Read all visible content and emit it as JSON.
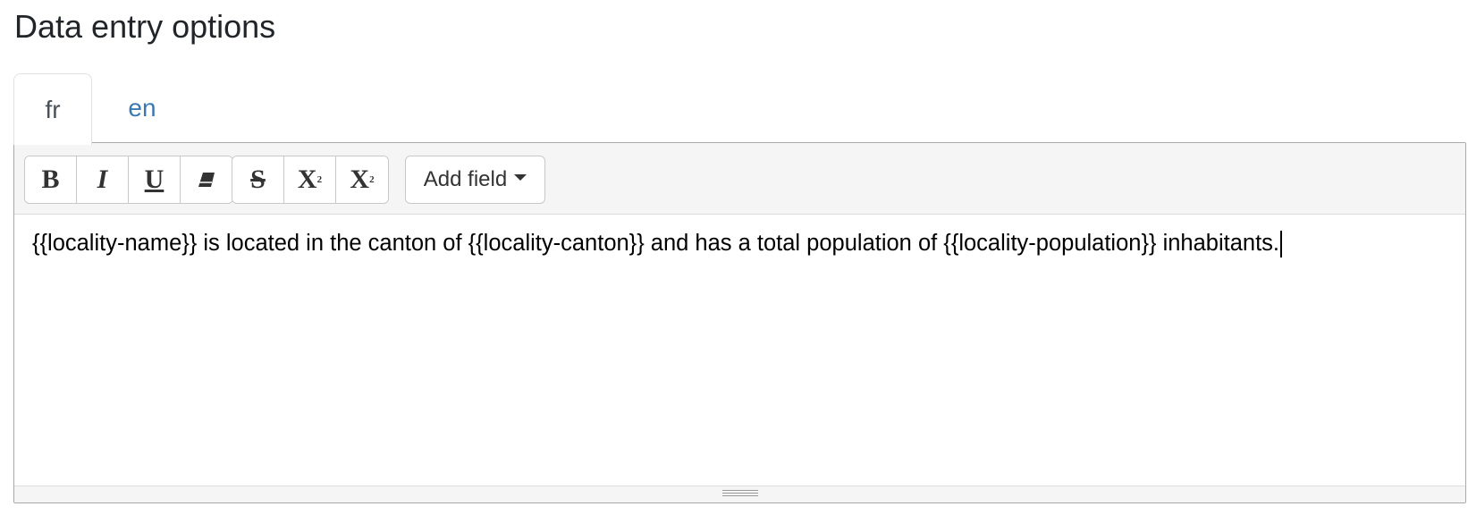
{
  "section": {
    "title": "Data entry options"
  },
  "tabs": [
    {
      "label": "fr",
      "active": true
    },
    {
      "label": "en",
      "active": false
    }
  ],
  "toolbar": {
    "bold_label": "B",
    "italic_label": "I",
    "underline_label": "U",
    "clear_icon": "eraser-icon",
    "strike_label": "S",
    "superscript_label": "X",
    "superscript_marker": "2",
    "subscript_label": "X",
    "subscript_marker": "2",
    "add_field_label": "Add field"
  },
  "editor": {
    "content": "{{locality-name}} is located in the canton of {{locality-canton}} and has a total population of {{locality-population}} inhabitants."
  },
  "colors": {
    "link_blue": "#3c78b0",
    "toolbar_bg": "#f5f5f5",
    "border": "#c8c8c8"
  }
}
